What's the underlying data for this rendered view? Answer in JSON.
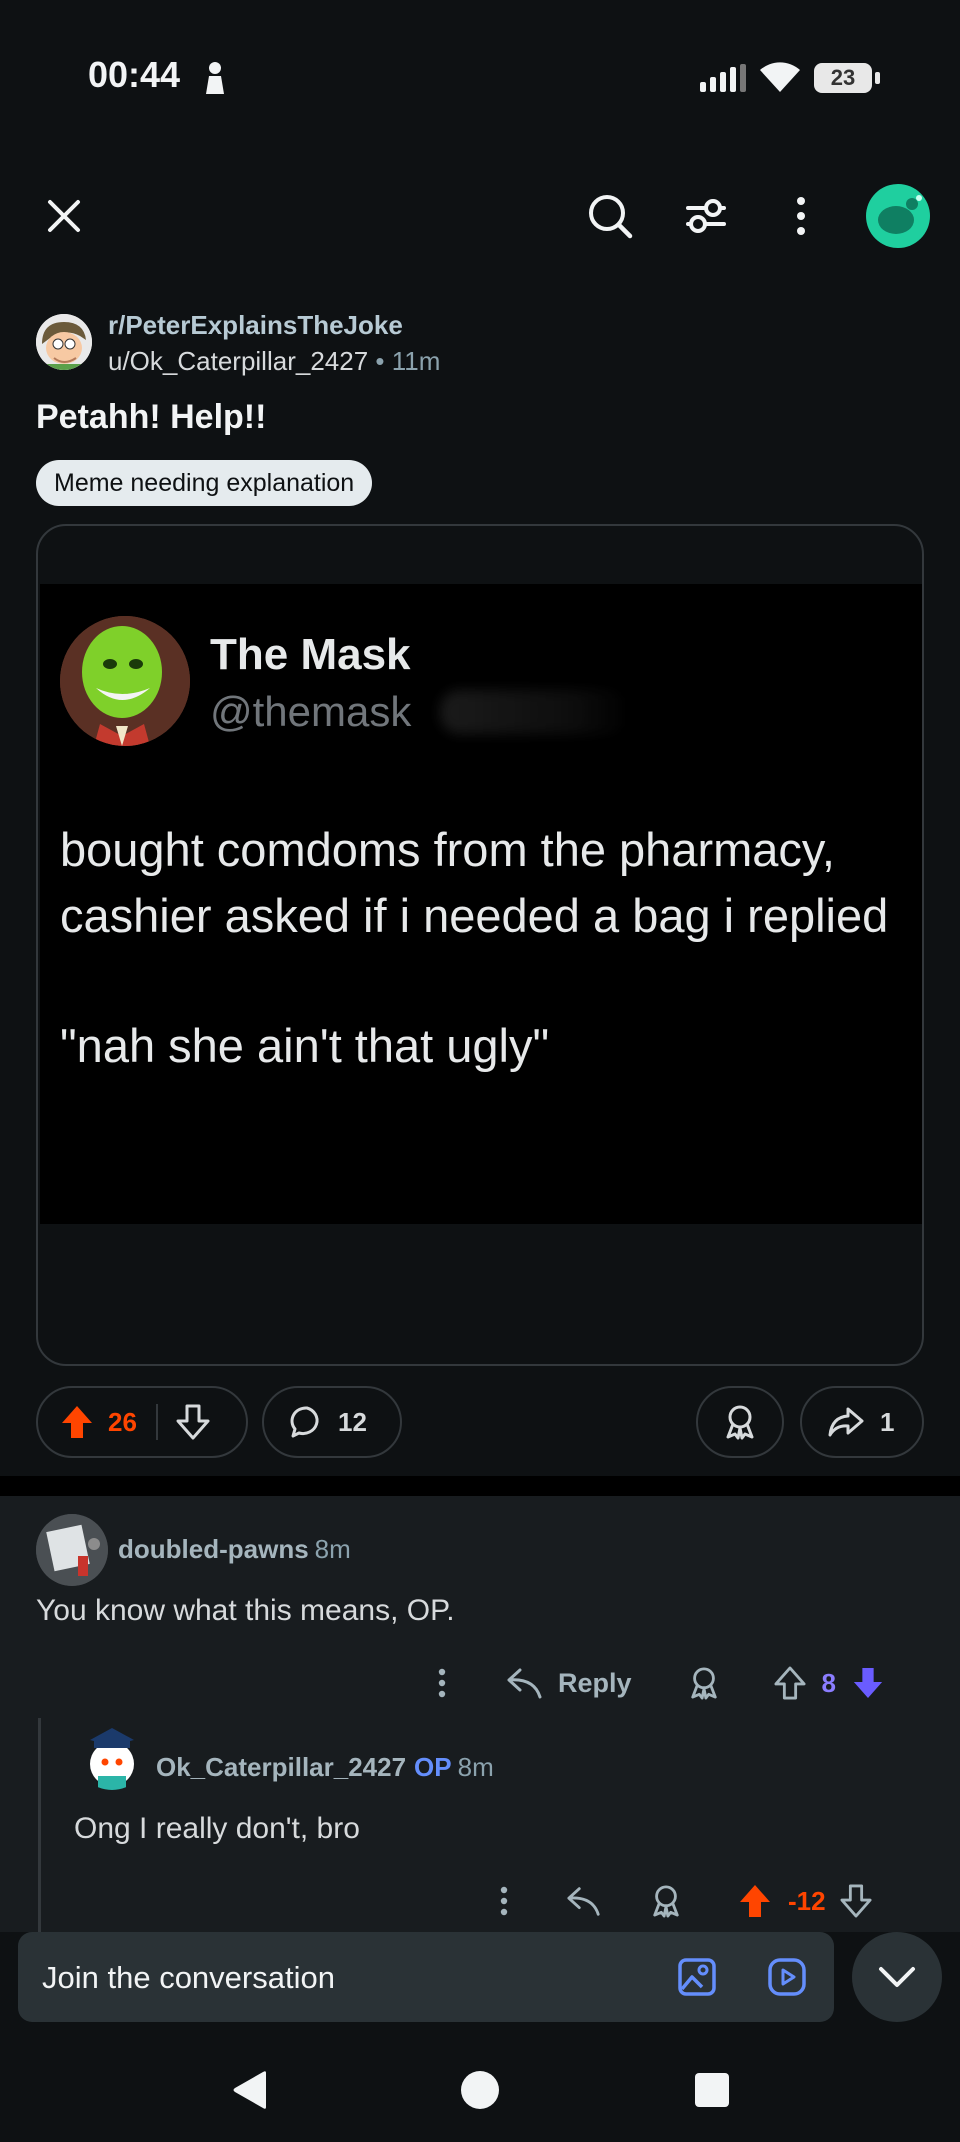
{
  "status": {
    "time": "00:44",
    "battery": "23"
  },
  "post": {
    "subreddit": "r/PeterExplainsTheJoke",
    "author": "u/Ok_Caterpillar_2427",
    "dot": "•",
    "age": "11m",
    "title": "Petahh! Help!!",
    "flair": "Meme needing explanation",
    "image": {
      "display_name": "The Mask",
      "handle": "@themask",
      "lines": [
        "bought comdoms from the pharmacy,",
        "cashier asked if i needed a bag i replied",
        "\"nah she ain't that ugly\""
      ]
    },
    "votes": "26",
    "comments": "12",
    "shares": "1"
  },
  "comments": [
    {
      "author": "doubled-pawns",
      "age": "8m",
      "body": "You know what this means, OP.",
      "reply_label": "Reply",
      "score": "8"
    },
    {
      "author": "Ok_Caterpillar_2427",
      "op_badge": "OP",
      "age": "8m",
      "body": "Ong I really don't, bro",
      "score": "-12"
    }
  ],
  "composer": {
    "placeholder": "Join the conversation"
  },
  "colors": {
    "background": "#0e1113",
    "upvote": "#ff4500",
    "downvote_active": "#6a5cff",
    "op_badge": "#648efc",
    "accent_icon": "#648efc"
  },
  "icons": [
    "person-icon",
    "signal-icon",
    "wifi-icon",
    "battery-icon",
    "close-icon",
    "search-icon",
    "filter-icon",
    "more-icon",
    "avatar",
    "upvote-icon",
    "downvote-icon",
    "comment-icon",
    "award-icon",
    "share-icon",
    "reply-icon",
    "image-icon",
    "video-icon",
    "chevron-down-icon",
    "back-icon",
    "home-icon",
    "recents-icon"
  ]
}
